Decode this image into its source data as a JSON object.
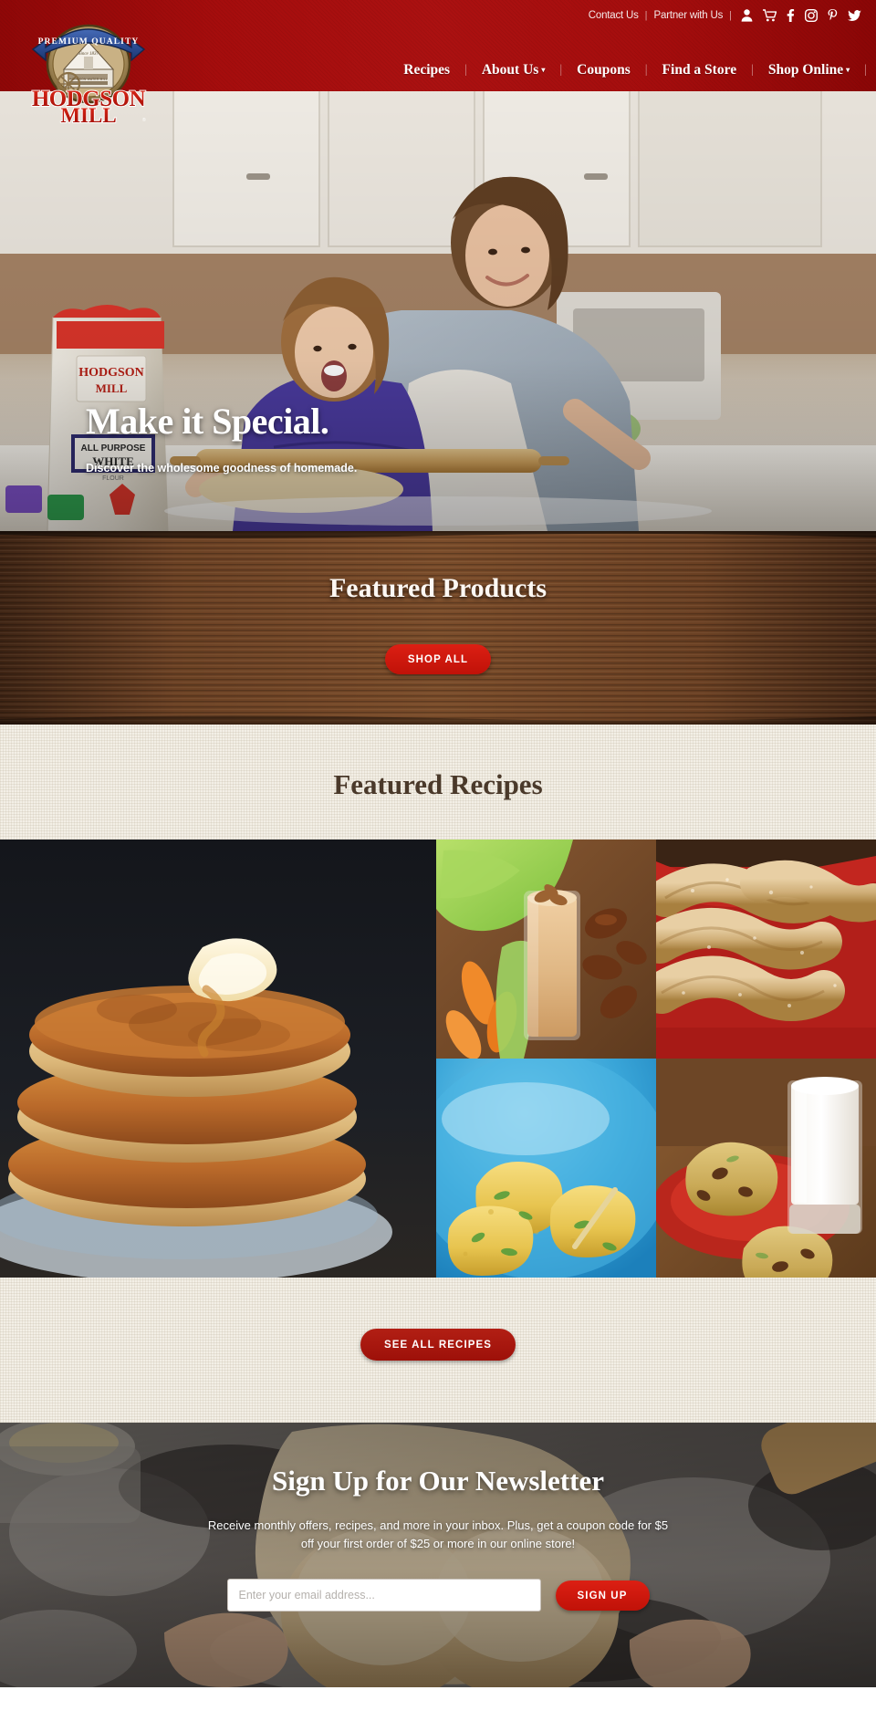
{
  "brand": {
    "logo_badge_text": "PREMIUM QUALITY",
    "logo_since": "Since 1837",
    "logo_name_line1": "HODGSON",
    "logo_name_line2": "MILL",
    "logo_mill_sign": "HODGSON WATER MILL",
    "accent_red": "#9e0b0b",
    "button_red": "#c01208",
    "wood_brown": "#5a3520",
    "cream": "#f3efe6",
    "heading_brown": "#4a392a"
  },
  "utility_nav": {
    "links": [
      {
        "label": "Contact Us",
        "name": "contact-us-link"
      },
      {
        "label": "Partner with Us",
        "name": "partner-with-us-link"
      }
    ],
    "separator": "|",
    "icons": [
      {
        "name": "account-icon",
        "title": "Account"
      },
      {
        "name": "shopping-cart-icon",
        "title": "Cart"
      },
      {
        "name": "facebook-icon",
        "title": "Facebook"
      },
      {
        "name": "instagram-icon",
        "title": "Instagram"
      },
      {
        "name": "pinterest-icon",
        "title": "Pinterest"
      },
      {
        "name": "twitter-icon",
        "title": "Twitter"
      }
    ]
  },
  "main_nav": {
    "separator": "|",
    "caret": "▾",
    "items": [
      {
        "label": "Recipes",
        "name": "nav-recipes",
        "has_dropdown": false
      },
      {
        "label": "About Us",
        "name": "nav-about-us",
        "has_dropdown": true
      },
      {
        "label": "Coupons",
        "name": "nav-coupons",
        "has_dropdown": false
      },
      {
        "label": "Find a Store",
        "name": "nav-find-a-store",
        "has_dropdown": false
      },
      {
        "label": "Shop Online",
        "name": "nav-shop-online",
        "has_dropdown": true
      }
    ]
  },
  "hero": {
    "title": "Make it Special.",
    "subtitle": "Discover the wholesome goodness of homemade.",
    "image_alt": "Mother and daughter rolling out dough in a kitchen with a bag of Hodgson Mill All Purpose White Flour"
  },
  "featured_products": {
    "title": "Featured Products",
    "shop_all_label": "SHOP ALL"
  },
  "featured_recipes": {
    "title": "Featured Recipes",
    "see_all_label": "SEE ALL RECIPES",
    "tiles": [
      {
        "name": "recipe-tile-pancakes",
        "alt": "Stack of golden pancakes topped with butter and syrup"
      },
      {
        "name": "recipe-tile-smoothie",
        "alt": "Creamy smoothie in a tall glass with pecans, carrots and dates"
      },
      {
        "name": "recipe-tile-crescents",
        "alt": "Basket of sugared whole wheat crescent rolls in a red cloth"
      },
      {
        "name": "recipe-tile-corn-muffins",
        "alt": "Jalapeno corn muffins broken open in a blue bowl"
      },
      {
        "name": "recipe-tile-cookies",
        "alt": "Oatmeal raisin cookies on a red plate beside a glass of milk"
      }
    ]
  },
  "newsletter": {
    "title": "Sign Up for Our Newsletter",
    "description": "Receive monthly offers, recipes, and more in your inbox. Plus, get a coupon code for $5 off your first order of $25 or more in our online store!",
    "email_placeholder": "Enter your email address...",
    "email_value": "",
    "signup_label": "SIGN UP",
    "image_alt": "Hands holding dough on a floured surface with a rolling pin and jar"
  }
}
